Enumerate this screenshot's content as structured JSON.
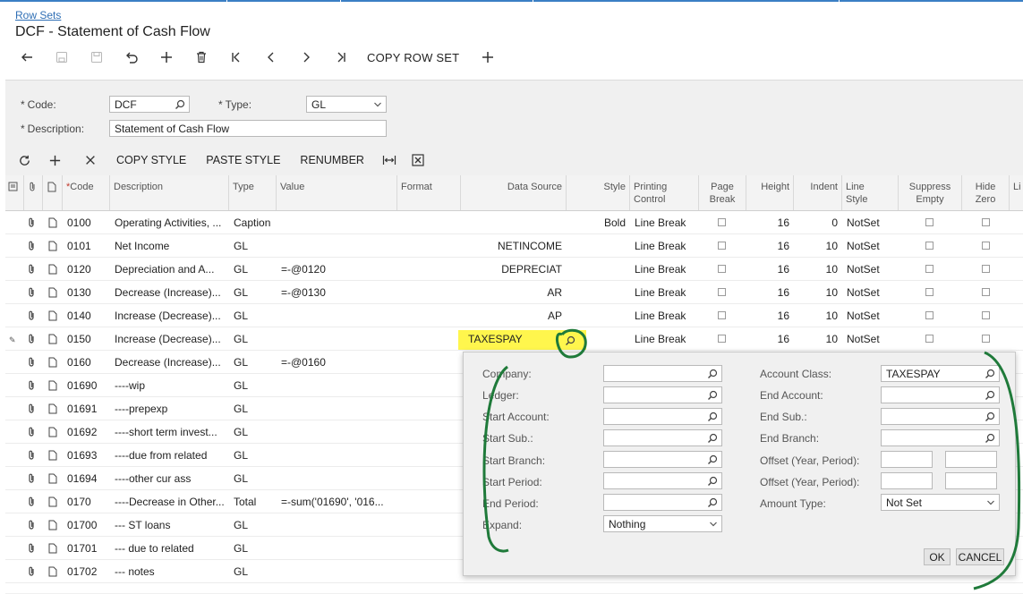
{
  "breadcrumb": "Row Sets",
  "page_title": "DCF - Statement of Cash Flow",
  "toolbar": {
    "copy_row_set": "COPY ROW SET"
  },
  "form": {
    "code_label": "Code:",
    "code_value": "DCF",
    "type_label": "Type:",
    "type_value": "GL",
    "description_label": "Description:",
    "description_value": "Statement of Cash Flow"
  },
  "grid_toolbar": {
    "copy_style": "COPY STYLE",
    "paste_style": "PASTE STYLE",
    "renumber": "RENUMBER"
  },
  "columns": {
    "code": "Code",
    "description": "Description",
    "type": "Type",
    "value": "Value",
    "format": "Format",
    "data_source": "Data Source",
    "style": "Style",
    "printing_control_1": "Printing",
    "printing_control_2": "Control",
    "page_break_1": "Page",
    "page_break_2": "Break",
    "height": "Height",
    "indent": "Indent",
    "line_style_1": "Line",
    "line_style_2": "Style",
    "suppress_empty_1": "Suppress",
    "suppress_empty_2": "Empty",
    "hide_zero_1": "Hide",
    "hide_zero_2": "Zero",
    "extra": "Li"
  },
  "rows": [
    {
      "code": "0100",
      "description": "Operating Activities, ...",
      "type": "Caption",
      "value": "",
      "source": "",
      "style": "Bold",
      "printing": "Line Break",
      "height": "16",
      "indent": "0",
      "linestyle": "NotSet"
    },
    {
      "code": "0101",
      "description": "Net Income",
      "type": "GL",
      "value": "",
      "source": "NETINCOME",
      "style": "",
      "printing": "Line Break",
      "height": "16",
      "indent": "10",
      "linestyle": "NotSet"
    },
    {
      "code": "0120",
      "description": "Depreciation and A...",
      "type": "GL",
      "value": "=-@0120",
      "source": "DEPRECIAT",
      "style": "",
      "printing": "Line Break",
      "height": "16",
      "indent": "10",
      "linestyle": "NotSet"
    },
    {
      "code": "0130",
      "description": "Decrease (Increase)...",
      "type": "GL",
      "value": "=-@0130",
      "source": "AR",
      "style": "",
      "printing": "Line Break",
      "height": "16",
      "indent": "10",
      "linestyle": "NotSet"
    },
    {
      "code": "0140",
      "description": "Increase (Decrease)...",
      "type": "GL",
      "value": "",
      "source": "AP",
      "style": "",
      "printing": "Line Break",
      "height": "16",
      "indent": "10",
      "linestyle": "NotSet"
    },
    {
      "code": "0150",
      "description": "Increase (Decrease)...",
      "type": "GL",
      "value": "",
      "source": "",
      "style": "",
      "printing": "Line Break",
      "height": "16",
      "indent": "10",
      "linestyle": "NotSet"
    },
    {
      "code": "0160",
      "description": "Decrease (Increase)...",
      "type": "GL",
      "value": "=-@0160",
      "source": "",
      "style": "",
      "printing": "",
      "height": "",
      "indent": "",
      "linestyle": ""
    },
    {
      "code": "01690",
      "description": "----wip",
      "type": "GL",
      "value": "",
      "source": "",
      "style": "",
      "printing": "",
      "height": "",
      "indent": "",
      "linestyle": ""
    },
    {
      "code": "01691",
      "description": "----prepexp",
      "type": "GL",
      "value": "",
      "source": "",
      "style": "",
      "printing": "",
      "height": "",
      "indent": "",
      "linestyle": ""
    },
    {
      "code": "01692",
      "description": "----short term invest...",
      "type": "GL",
      "value": "",
      "source": "",
      "style": "",
      "printing": "",
      "height": "",
      "indent": "",
      "linestyle": ""
    },
    {
      "code": "01693",
      "description": "----due from related",
      "type": "GL",
      "value": "",
      "source": "",
      "style": "",
      "printing": "",
      "height": "",
      "indent": "",
      "linestyle": ""
    },
    {
      "code": "01694",
      "description": "----other cur ass",
      "type": "GL",
      "value": "",
      "source": "",
      "style": "",
      "printing": "",
      "height": "",
      "indent": "",
      "linestyle": ""
    },
    {
      "code": "0170",
      "description": "----Decrease in Other...",
      "type": "Total",
      "value": "=-sum('01690', '016...",
      "source": "",
      "style": "",
      "printing": "",
      "height": "",
      "indent": "",
      "linestyle": ""
    },
    {
      "code": "01700",
      "description": "--- ST loans",
      "type": "GL",
      "value": "",
      "source": "",
      "style": "",
      "printing": "",
      "height": "",
      "indent": "",
      "linestyle": ""
    },
    {
      "code": "01701",
      "description": "--- due to related",
      "type": "GL",
      "value": "",
      "source": "",
      "style": "",
      "printing": "",
      "height": "",
      "indent": "",
      "linestyle": ""
    },
    {
      "code": "01702",
      "description": "--- notes",
      "type": "GL",
      "value": "",
      "source": "",
      "style": "",
      "printing": "",
      "height": "",
      "indent": "",
      "linestyle": ""
    }
  ],
  "editing": {
    "data_source_value": "TAXESPAY"
  },
  "popup": {
    "company": "Company:",
    "ledger": "Ledger:",
    "start_account": "Start Account:",
    "start_sub": "Start Sub.:",
    "start_branch": "Start Branch:",
    "start_period": "Start Period:",
    "end_period": "End Period:",
    "expand": "Expand:",
    "expand_value": "Nothing",
    "account_class": "Account Class:",
    "account_class_value": "TAXESPAY",
    "end_account": "End Account:",
    "end_sub": "End Sub.:",
    "end_branch": "End Branch:",
    "offset1": "Offset (Year, Period):",
    "offset2": "Offset (Year, Period):",
    "amount_type": "Amount Type:",
    "amount_type_value": "Not Set",
    "ok": "OK",
    "cancel": "CANCEL"
  },
  "colors": {
    "link": "#2f6fb5",
    "highlight": "#fff42e",
    "annotation": "#1f7a3a"
  }
}
